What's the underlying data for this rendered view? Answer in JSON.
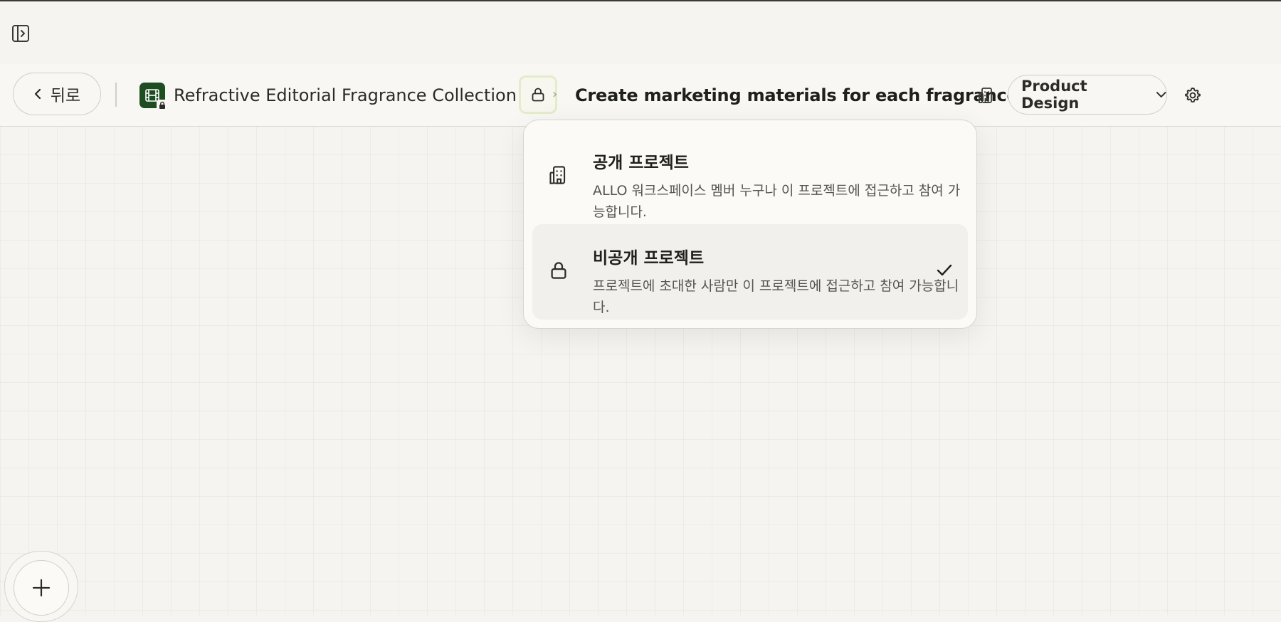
{
  "header": {
    "back_label": "뒤로",
    "project_title": "Refractive Editorial Fragrance Collection",
    "task_title": "Create marketing materials for each fragrance",
    "team_select": {
      "selected": "Product Design"
    }
  },
  "visibility_menu": {
    "options": [
      {
        "title": "공개 프로젝트",
        "description": "ALLO 워크스페이스 멤버 누구나 이 프로젝트에 접근하고 참여 가능합니다.",
        "icon": "building-icon",
        "selected": false
      },
      {
        "title": "비공개 프로젝트",
        "description": "프로젝트에 초대한 사람만 이 프로젝트에 접근하고 참여 가능합니다.",
        "icon": "lock-icon",
        "selected": true
      }
    ]
  },
  "colors": {
    "background": "#f5f4f0",
    "project_icon": "#1e4d22",
    "lock_button_border": "#e4ecca",
    "selected_option": "#f1f0ec"
  }
}
